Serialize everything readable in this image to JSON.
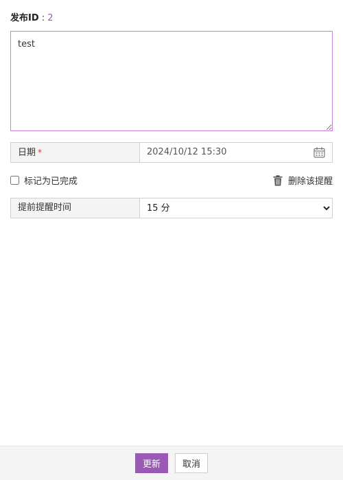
{
  "header": {
    "pub_id_label": "发布ID",
    "pub_id_separator": " : ",
    "pub_id_value": "2"
  },
  "note": {
    "value": "test"
  },
  "date_field": {
    "label": "日期",
    "required_mark": "*",
    "value": "2024/10/12 15:30",
    "icon": "calendar-icon"
  },
  "complete": {
    "label": "标记为已完成",
    "checked": false
  },
  "delete": {
    "label": "删除该提醒",
    "icon": "trash-icon"
  },
  "reminder": {
    "label": "提前提醒时间",
    "selected": "15 分"
  },
  "footer": {
    "update_label": "更新",
    "cancel_label": "取消"
  },
  "colors": {
    "accent": "#9b59b6",
    "focus_border": "#c77ddb",
    "required": "#e03030"
  }
}
